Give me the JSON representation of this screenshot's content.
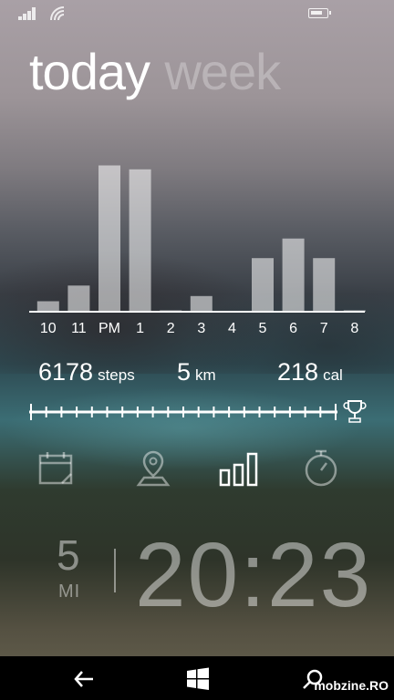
{
  "status_bar": {
    "icons": [
      "signal-icon",
      "wifi-icon",
      "battery-icon"
    ]
  },
  "pivot": {
    "active_label": "today",
    "inactive_label": "week"
  },
  "chart_data": {
    "type": "bar",
    "categories": [
      "10",
      "11",
      "PM",
      "1",
      "2",
      "3",
      "4",
      "5",
      "6",
      "7",
      "8"
    ],
    "values": [
      8,
      20,
      112,
      109,
      0.5,
      12,
      0,
      41,
      56,
      41,
      0.5
    ],
    "ylim": [
      0,
      120
    ]
  },
  "stats": {
    "steps": {
      "value": "6178",
      "unit": "steps"
    },
    "distance": {
      "value": "5",
      "unit": "km"
    },
    "calories": {
      "value": "218",
      "unit": "cal"
    }
  },
  "goal": {
    "ticks": 20,
    "icon": "trophy-icon"
  },
  "view_icons": [
    "calendar-icon",
    "map-pin-icon",
    "bar-chart-icon",
    "stopwatch-icon"
  ],
  "tracker": {
    "distance_value": "5",
    "distance_unit": "MI",
    "time": "20:23"
  },
  "nav_bar": {
    "icons": [
      "back-icon",
      "windows-icon",
      "search-icon"
    ]
  },
  "watermark": "mobzine.RO",
  "colors": {
    "text": "#ffffff",
    "nav_bar": "#000000"
  }
}
